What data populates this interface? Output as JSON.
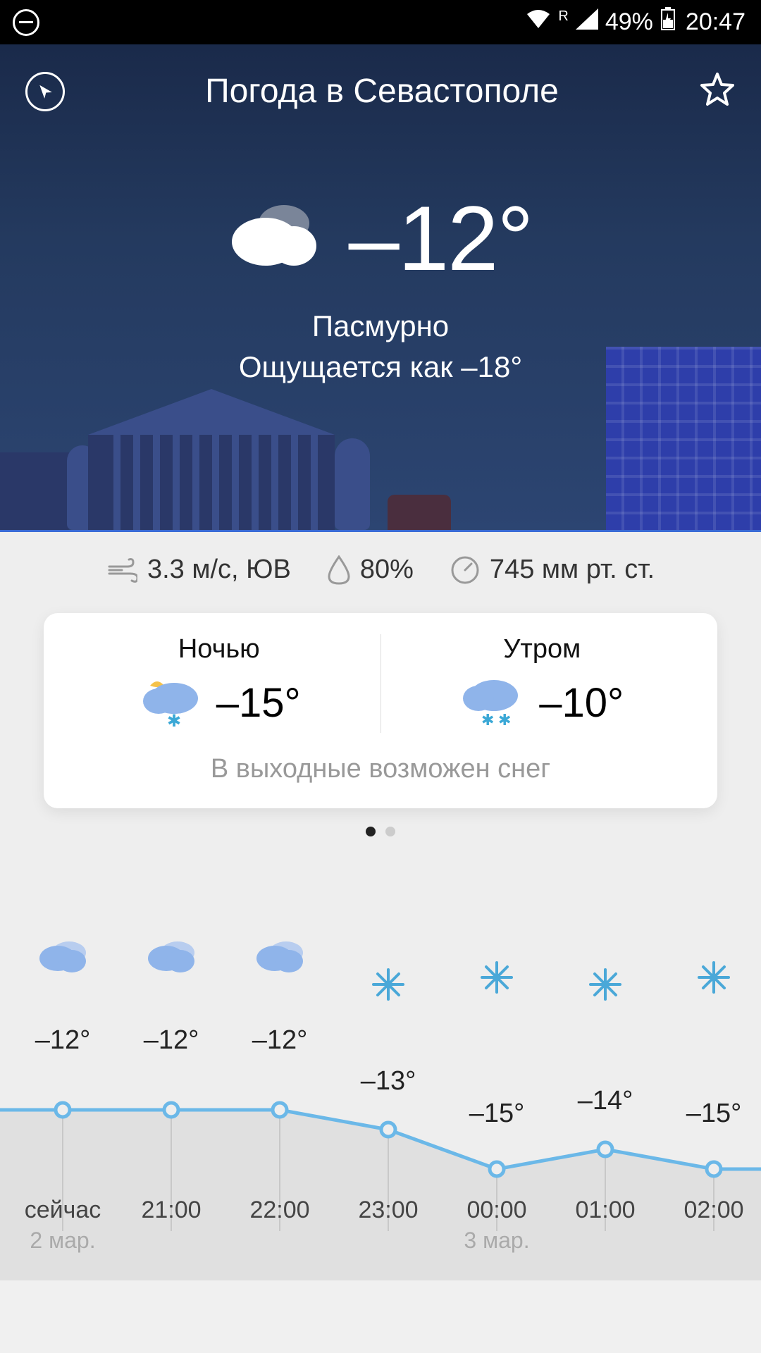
{
  "status": {
    "battery_pct": "49%",
    "time": "20:47",
    "roam": "R"
  },
  "header": {
    "title": "Погода в Севастополе"
  },
  "current": {
    "temp": "–12°",
    "condition": "Пасмурно",
    "feels_like": "Ощущается как –18°"
  },
  "metrics": {
    "wind": "3.3 м/с, ЮВ",
    "humidity": "80%",
    "pressure": "745 мм рт. ст."
  },
  "forecast": {
    "periods": [
      {
        "label": "Ночью",
        "temp": "–15°"
      },
      {
        "label": "Утром",
        "temp": "–10°"
      }
    ],
    "note": "В выходные возможен снег"
  },
  "hourly": [
    {
      "time": "сейчас",
      "date": "2 мар.",
      "temp": "–12°",
      "icon": "cloud",
      "temp_val": -12
    },
    {
      "time": "21:00",
      "date": "",
      "temp": "–12°",
      "icon": "cloud",
      "temp_val": -12
    },
    {
      "time": "22:00",
      "date": "",
      "temp": "–12°",
      "icon": "cloud",
      "temp_val": -12
    },
    {
      "time": "23:00",
      "date": "",
      "temp": "–13°",
      "icon": "snow",
      "temp_val": -13
    },
    {
      "time": "00:00",
      "date": "3 мар.",
      "temp": "–15°",
      "icon": "snow",
      "temp_val": -15
    },
    {
      "time": "01:00",
      "date": "",
      "temp": "–14°",
      "icon": "snow",
      "temp_val": -14
    },
    {
      "time": "02:00",
      "date": "",
      "temp": "–15°",
      "icon": "snow",
      "temp_val": -15
    }
  ],
  "chart_data": {
    "type": "line",
    "title": "",
    "xlabel": "",
    "ylabel": "",
    "categories": [
      "сейчас",
      "21:00",
      "22:00",
      "23:00",
      "00:00",
      "01:00",
      "02:00"
    ],
    "values": [
      -12,
      -12,
      -12,
      -13,
      -15,
      -14,
      -15
    ],
    "ylim": [
      -16,
      -11
    ]
  }
}
